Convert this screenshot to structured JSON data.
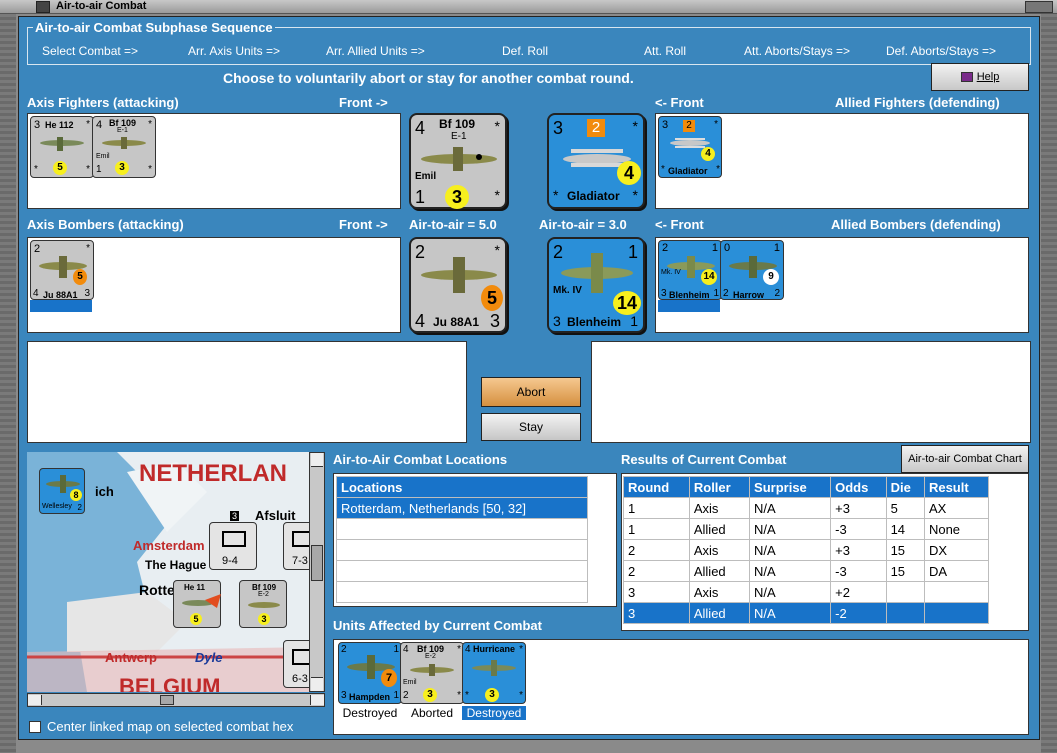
{
  "window": {
    "title": "Air-to-air Combat"
  },
  "sequence": {
    "title": "Air-to-air Combat Subphase Sequence",
    "steps": [
      "Select Combat =>",
      "Arr. Axis Units =>",
      "Arr. Allied Units =>",
      "Def. Roll",
      "Att. Roll",
      "Att. Aborts/Stays =>",
      "Def. Aborts/Stays =>"
    ]
  },
  "prompt": "Choose to voluntarily abort or stay for another combat round.",
  "help_label": "Help",
  "labels": {
    "axis_fighters": "Axis Fighters (attacking)",
    "front_right": "Front ->",
    "front_left": "<- Front",
    "allied_fighters": "Allied Fighters (defending)",
    "axis_bombers": "Axis Bombers (attacking)",
    "air_to_air_axis": "Air-to-air = 5.0",
    "air_to_air_allied": "Air-to-air = 3.0",
    "allied_bombers": "Allied Bombers (defending)"
  },
  "buttons": {
    "abort": "Abort",
    "stay": "Stay",
    "chart": "Air-to-air Combat Chart"
  },
  "axis_fighter_counters": [
    {
      "tl": "3",
      "name": "He 112",
      "tr": "*",
      "bl": "*",
      "br": "*",
      "val": "5"
    },
    {
      "tl": "4",
      "name": "Bf 109",
      "sub": "E-1",
      "tr": "*",
      "nick": "Emil",
      "bl": "1",
      "br": "*",
      "val": "3"
    }
  ],
  "front_axis_fighter": {
    "tl": "4",
    "name": "Bf 109",
    "sub": "E-1",
    "tr": "*",
    "nick": "Emil",
    "bl": "1",
    "br": "*",
    "val": "3"
  },
  "front_allied_fighter": {
    "tl": "3",
    "box": "2",
    "tr": "*",
    "name": "Gladiator",
    "bl": "*",
    "br": "*",
    "val": "4"
  },
  "allied_fighter_counters": [
    {
      "tl": "3",
      "box": "2",
      "tr": "*",
      "name": "Gladiator",
      "bl": "*",
      "br": "*",
      "val": "4"
    }
  ],
  "axis_bomber_counters": [
    {
      "tl": "2",
      "tr": "*",
      "name": "Ju 88A1",
      "bl": "4",
      "br": "3",
      "val": "5"
    }
  ],
  "front_axis_bomber": {
    "tl": "2",
    "tr": "*",
    "name": "Ju 88A1",
    "bl": "4",
    "br": "3",
    "val": "5"
  },
  "front_allied_bomber": {
    "tl": "2",
    "tr": "1",
    "sub": "Mk. IV",
    "name": "Blenheim",
    "bl": "3",
    "br": "1",
    "val": "14"
  },
  "allied_bomber_counters": [
    {
      "tl": "2",
      "tr": "1",
      "sub": "Mk. IV",
      "name": "Blenheim",
      "bl": "3",
      "br": "1",
      "val": "14"
    },
    {
      "tl": "0",
      "tr": "1",
      "name": "Harrow",
      "bl": "2",
      "br": "2",
      "val": "9"
    }
  ],
  "map": {
    "labels": {
      "netherlands": "NETHERLAN",
      "amsterdam": "Amsterdam",
      "hague": "The Hague",
      "rotterdam": "Rotterd",
      "afsluit": "Afsluit",
      "antwerp": "Antwerp",
      "dyle": "Dyle",
      "belgium": "BELGIUM",
      "ich": "ich"
    },
    "units": {
      "wellesley_val": "8",
      "wellesley_name": "Wellesley",
      "wellesley_tl": "2",
      "inf1_top": "3",
      "inf1_val": "9-4",
      "inf2_val": "7-3",
      "inf3_val": "6-3",
      "bf_val": "3",
      "he_val": "5",
      "he_name": "He 11",
      "bf_name": "Bf 109",
      "bf_sub": "E-2"
    },
    "center_label": "Center linked map on selected combat hex",
    "center_checked": false
  },
  "locations": {
    "title": "Air-to-Air Combat Locations",
    "header": "Locations",
    "rows": [
      "Rotterdam, Netherlands [50, 32]",
      "",
      "",
      "",
      ""
    ]
  },
  "results": {
    "title": "Results of Current Combat",
    "columns": [
      "Round",
      "Roller",
      "Surprise",
      "Odds",
      "Die",
      "Result"
    ],
    "rows": [
      [
        "1",
        "Axis",
        "N/A",
        "+3",
        "5",
        "AX"
      ],
      [
        "1",
        "Allied",
        "N/A",
        "-3",
        "14",
        "None"
      ],
      [
        "2",
        "Axis",
        "N/A",
        "+3",
        "15",
        "DX"
      ],
      [
        "2",
        "Allied",
        "N/A",
        "-3",
        "15",
        "DA"
      ],
      [
        "3",
        "Axis",
        "N/A",
        "+2",
        "",
        ""
      ],
      [
        "3",
        "Allied",
        "N/A",
        "-2",
        "",
        ""
      ]
    ],
    "selected_row": 5
  },
  "affected": {
    "title": "Units Affected by Current Combat",
    "units": [
      {
        "tl": "2",
        "tr": "1",
        "name": "Hampden",
        "bl": "3",
        "br": "1",
        "val": "7",
        "status": "Destroyed"
      },
      {
        "tl": "4",
        "name": "Bf 109",
        "sub": "E-2",
        "tr": "*",
        "nick": "Emil",
        "bl": "2",
        "br": "*",
        "val": "3",
        "status": "Aborted"
      },
      {
        "tl": "4",
        "name": "Hurricane",
        "tr": "*",
        "bl": "*",
        "br": "*",
        "val": "3",
        "status": "Destroyed"
      }
    ]
  },
  "colors": {
    "panel_bg": "#3a86bd",
    "select_blue": "#1873c9",
    "counter_gray": "#c6c6c6",
    "counter_blue": "#2a8fd8",
    "dot_yellow": "#f7ef1e",
    "dot_orange": "#f28b0c"
  }
}
